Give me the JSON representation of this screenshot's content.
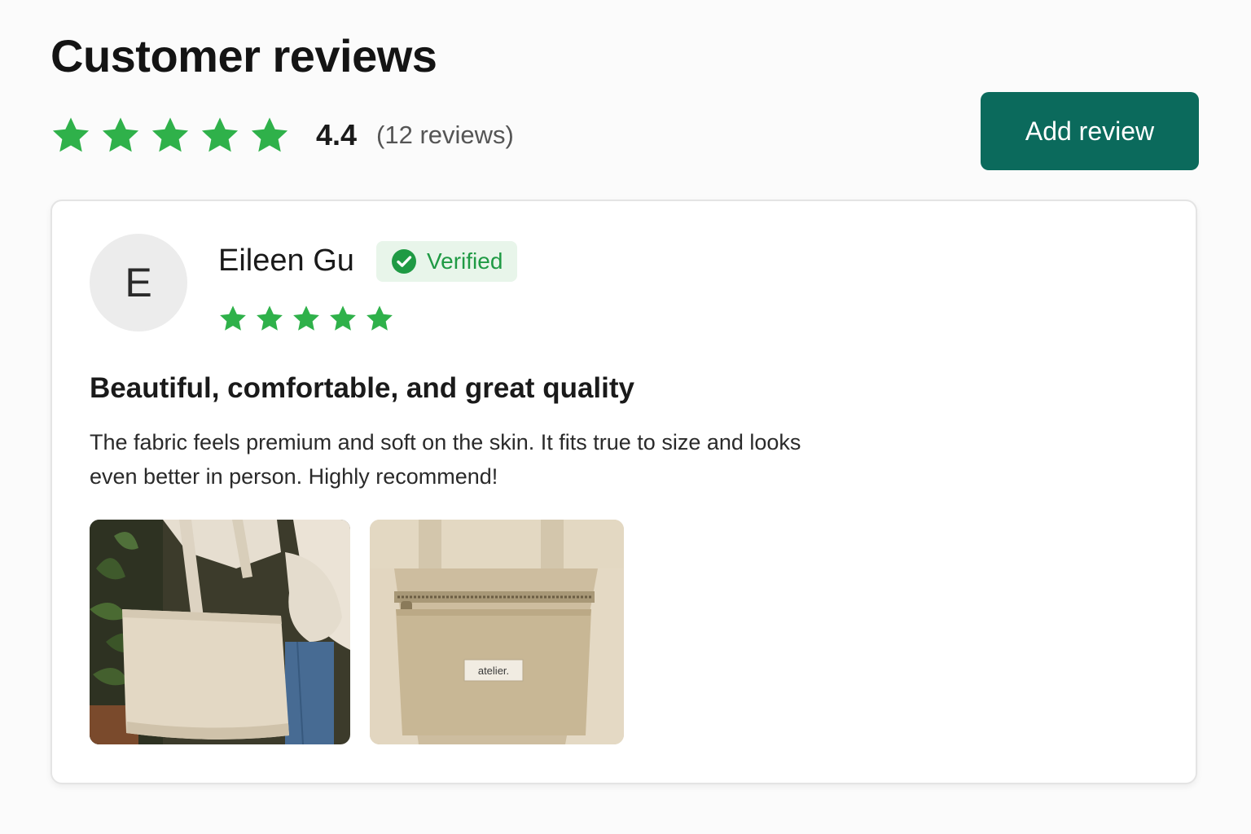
{
  "header": {
    "title": "Customer reviews",
    "average_rating": "4.4",
    "review_count": "(12 reviews)",
    "rating_value": 4.4,
    "rating_max": 5,
    "add_review_label": "Add review"
  },
  "review": {
    "avatar_initial": "E",
    "reviewer_name": "Eileen Gu",
    "badge_label": "Verified",
    "rating_value": 5,
    "title": "Beautiful, comfortable, and great quality",
    "body": "The fabric feels premium and soft on the skin. It fits true to size and looks even better in person. Highly recommend!",
    "photos": [
      {
        "icon": "tote-bag-worn-photo"
      },
      {
        "icon": "tote-bag-interior-photo",
        "label_text": "atelier."
      }
    ]
  },
  "colors": {
    "star": "#2fb14a",
    "button": "#0b6a5c",
    "badge_bg": "#e8f5ea",
    "badge_text": "#1f9a44"
  }
}
